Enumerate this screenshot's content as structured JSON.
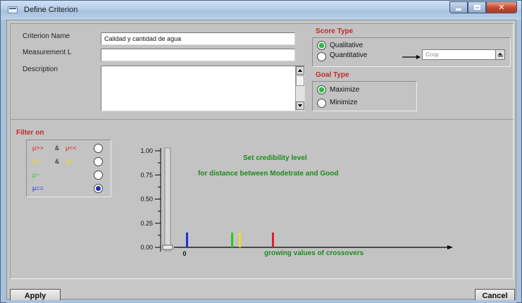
{
  "window": {
    "title": "Define Criterion"
  },
  "fields": {
    "criterion_name_label": "Criterion Name",
    "criterion_name_value": "Calidad y cantidad de agua",
    "measurement_label": "Measurement L",
    "measurement_value": "",
    "description_label": "Description",
    "description_value": ""
  },
  "score_type": {
    "title": "Score Type",
    "options": [
      "Qualitative",
      "Quantitative"
    ],
    "selected": "Qualitative",
    "combo_value": "Ccop"
  },
  "goal_type": {
    "title": "Goal Type",
    "options": [
      "Maximize",
      "Minimize"
    ],
    "selected": "Maximize"
  },
  "filter": {
    "title": "Filter on",
    "rows": [
      {
        "a": "μ>>",
        "amp": "&",
        "b": "μ<<",
        "color_a": "#e02020",
        "color_b": "#e02020",
        "selected": false
      },
      {
        "a": "μ<",
        "amp": "&",
        "b": "μ>",
        "color_a": "#e8e020",
        "color_b": "#e8e020",
        "selected": false
      },
      {
        "a": "μ~",
        "amp": "",
        "b": "",
        "color_a": "#22cc22",
        "color_b": "#22cc22",
        "selected": false
      },
      {
        "a": "μ==",
        "amp": "",
        "b": "",
        "color_a": "#2030e0",
        "color_b": "#2030e0",
        "selected": true
      }
    ]
  },
  "chart": {
    "annotation_line1": "Set credibility level",
    "annotation_line2": "for distance between Modetrate and Good",
    "x_axis_label": "growing values of crossovers",
    "x_origin_label": "0",
    "y_ticks": [
      "1.00",
      "0.75",
      "0.50",
      "0.25",
      "0.00"
    ],
    "slider_value": 0.0
  },
  "chart_data": {
    "type": "bar",
    "y_ticks": [
      1.0,
      0.75,
      0.5,
      0.25,
      0.0
    ],
    "ylim": [
      0,
      1
    ],
    "grid": false,
    "bars": [
      {
        "color": "#1b2fe0"
      },
      {
        "color": "#22cc22"
      },
      {
        "color": "#e8e020"
      },
      {
        "color": "#e02020"
      }
    ]
  },
  "buttons": {
    "apply": "Apply",
    "cancel": "Cancel"
  },
  "colors": {
    "accent_red": "#c22a2a",
    "accent_green": "#1e8a1e"
  }
}
